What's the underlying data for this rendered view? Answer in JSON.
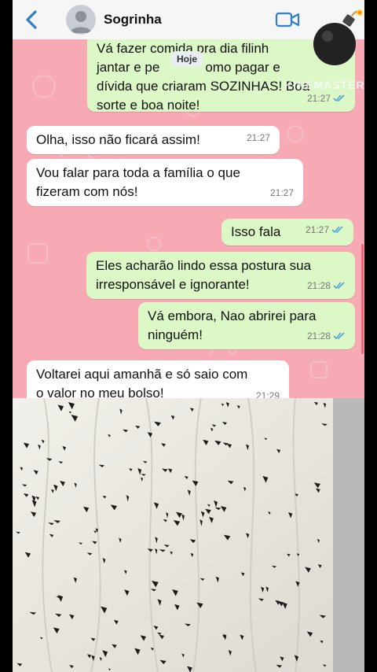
{
  "header": {
    "contact_name": "Sogrinha",
    "back_icon": "chevron-left-icon",
    "video_icon": "video-camera-icon",
    "sticker_icon": "bomb-icon"
  },
  "date_pill": "Hoje",
  "watermark": "KINEMASTER",
  "messages": [
    {
      "dir": "out",
      "lines": [
        "Vá fazer comida pra dia filinh",
        "jantar e pe",
        "dívida que criaram SOZINHAS! Boa",
        "sorte e boa noite!"
      ],
      "line2_tail": "omo pagar e",
      "time": "21:27"
    },
    {
      "dir": "in",
      "lines": [
        "Olha, isso não ficará assim!"
      ],
      "time": "21:27"
    },
    {
      "dir": "in",
      "lines": [
        "Vou falar para toda a família o que",
        "fizeram com nós!"
      ],
      "time": "21:27"
    },
    {
      "dir": "out",
      "lines": [
        "Isso fala"
      ],
      "time": "21:27"
    },
    {
      "dir": "out",
      "lines": [
        "Eles acharão lindo essa postura sua",
        "irresponsável e ignorante!"
      ],
      "time": "21:28"
    },
    {
      "dir": "out",
      "lines": [
        "Vá embora, Nao abrirei para",
        "ninguém!"
      ],
      "time": "21:28"
    },
    {
      "dir": "in",
      "lines": [
        "Voltarei aqui amanhã e só saio com",
        "o valor no meu bolso!"
      ],
      "time": "21:29"
    }
  ],
  "colors": {
    "chat_bg": "#f7a9b4",
    "bubble_in": "#ffffff",
    "bubble_out": "#dcf8c6",
    "tick_blue": "#4fa3e0",
    "header_bg": "#f6f6f6",
    "accent": "#2f7fd1"
  }
}
